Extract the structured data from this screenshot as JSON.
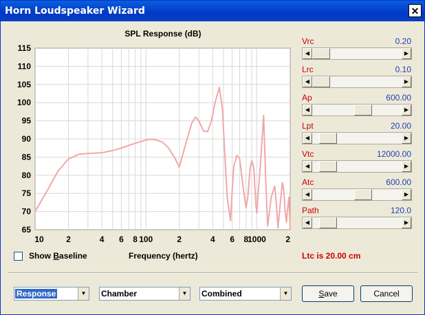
{
  "window": {
    "title": "Horn Loudspeaker Wizard",
    "close_glyph": "✕"
  },
  "chart_data": {
    "type": "line",
    "title": "SPL Response (dB)",
    "xlabel": "Frequency (hertz)",
    "ylabel": "",
    "x_scale": "log",
    "xlim": [
      10,
      2000
    ],
    "ylim": [
      65,
      115
    ],
    "y_ticks": [
      115,
      110,
      105,
      100,
      95,
      90,
      85,
      80,
      75,
      70,
      65
    ],
    "x_ticks": [
      {
        "v": 10,
        "label": "10"
      },
      {
        "v": 20,
        "label": "2"
      },
      {
        "v": 40,
        "label": "4"
      },
      {
        "v": 60,
        "label": "6"
      },
      {
        "v": 80,
        "label": "8"
      },
      {
        "v": 100,
        "label": "100"
      },
      {
        "v": 200,
        "label": "2"
      },
      {
        "v": 400,
        "label": "4"
      },
      {
        "v": 600,
        "label": "6"
      },
      {
        "v": 800,
        "label": "8"
      },
      {
        "v": 1000,
        "label": "1000"
      },
      {
        "v": 2000,
        "label": "2"
      }
    ],
    "grid": true,
    "color": "#f0a8a8",
    "series": [
      {
        "x": [
          10,
          13,
          16,
          20,
          25,
          30,
          40,
          50,
          60,
          70,
          80,
          90,
          100,
          110,
          120,
          140,
          160,
          180,
          200,
          230,
          260,
          280,
          300,
          330,
          360,
          390,
          420,
          460,
          490,
          510,
          540,
          580,
          600,
          620,
          660,
          700,
          750,
          800,
          830,
          870,
          900,
          940,
          980,
          1000,
          1020,
          1060,
          1100,
          1150,
          1200,
          1250,
          1300,
          1350,
          1450,
          1500,
          1550,
          1600,
          1650,
          1700,
          1750,
          1800,
          1850,
          1900,
          1950,
          2000
        ],
        "y": [
          70,
          76,
          81,
          84.5,
          85.8,
          86,
          86.2,
          86.8,
          87.5,
          88.2,
          88.8,
          89.3,
          89.7,
          89.9,
          89.8,
          89.2,
          87.5,
          85,
          82.3,
          89,
          94.5,
          96,
          95,
          92.2,
          92,
          95,
          100,
          104.2,
          98,
          88,
          74,
          67.5,
          76,
          82.5,
          85.5,
          84.5,
          77,
          71,
          74,
          82,
          84,
          82,
          72,
          69.5,
          74,
          80,
          87,
          96.5,
          80,
          66,
          70,
          74,
          77,
          72,
          65.5,
          70,
          74,
          78,
          76,
          70,
          67,
          71,
          74,
          65
        ]
      }
    ]
  },
  "sliders": [
    {
      "label": "Vrc",
      "value": "0.20",
      "position": 0.0
    },
    {
      "label": "Lrc",
      "value": "0.10",
      "position": 0.0
    },
    {
      "label": "Ap",
      "value": "600.00",
      "position": 0.59
    },
    {
      "label": "Lpt",
      "value": "20.00",
      "position": 0.1
    },
    {
      "label": "Vtc",
      "value": "12000.00",
      "position": 0.1
    },
    {
      "label": "Atc",
      "value": "600.00",
      "position": 0.59
    },
    {
      "label": "Path",
      "value": "120.0",
      "position": 0.1
    }
  ],
  "status_text": "Ltc is 20.00 cm",
  "show_baseline": {
    "pre": "Show ",
    "accel": "B",
    "post": "aseline",
    "checked": false
  },
  "combos": [
    {
      "value": "Response"
    },
    {
      "value": "Chamber"
    },
    {
      "value": "Combined"
    }
  ],
  "buttons": {
    "save": {
      "accel": "S",
      "rest": "ave"
    },
    "cancel": "Cancel"
  },
  "icons": {
    "left": "◀",
    "right": "▶",
    "down": "▼"
  }
}
